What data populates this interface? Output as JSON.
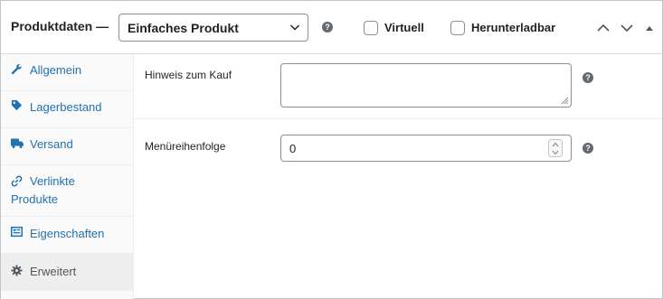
{
  "header": {
    "title": "Produktdaten —",
    "product_type": "Einfaches Produkt",
    "help_icon": "question-circle-icon",
    "virtual_label": "Virtuell",
    "virtual_checked": false,
    "downloadable_label": "Herunterladbar",
    "downloadable_checked": false,
    "controls": [
      "chevron-up-icon",
      "chevron-down-icon",
      "triangle-up-icon"
    ]
  },
  "sidebar": {
    "items": [
      {
        "label": "Allgemein",
        "icon": "wrench-icon"
      },
      {
        "label": "Lagerbestand",
        "icon": "tag-icon"
      },
      {
        "label": "Versand",
        "icon": "truck-icon"
      },
      {
        "label_line1": "Verlinkte",
        "label_line2": "Produkte",
        "icon": "link-icon"
      },
      {
        "label": "Eigenschaften",
        "icon": "list-icon"
      },
      {
        "label": "Erweitert",
        "icon": "gear-icon",
        "active": true
      }
    ]
  },
  "main": {
    "purchase_note": {
      "label": "Hinweis zum Kauf",
      "value": ""
    },
    "menu_order": {
      "label": "Menüreihenfolge",
      "value": "0"
    }
  },
  "colors": {
    "link": "#2271b1",
    "text": "#1d2327",
    "border": "#8c8f94",
    "sidebar_bg": "#fafafa",
    "active_tab": "#eee"
  }
}
